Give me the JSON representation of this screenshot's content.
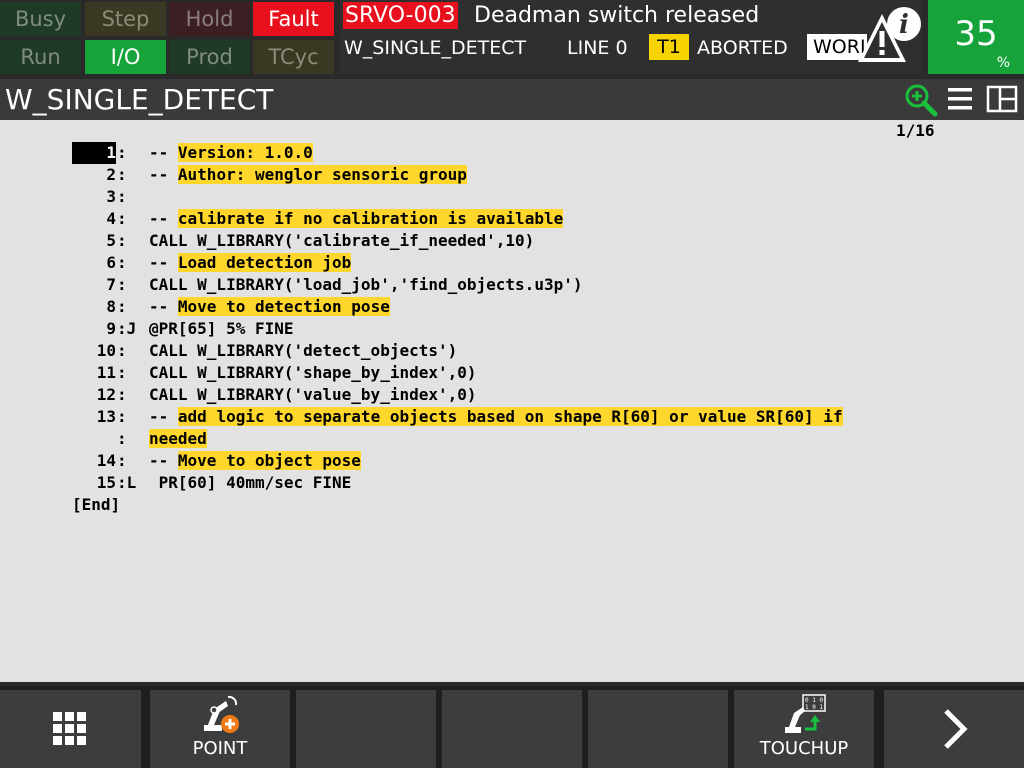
{
  "status_flags": {
    "busy": "Busy",
    "step": "Step",
    "hold": "Hold",
    "fault": "Fault",
    "run": "Run",
    "io": "I/O",
    "prod": "Prod",
    "tcyc": "TCyc"
  },
  "alarm": {
    "code": "SRVO-003",
    "message": "Deadman switch released",
    "program": "W_SINGLE_DETECT",
    "line": "LINE 0",
    "mode": "T1",
    "state": "ABORTED",
    "status_box": "WORLD",
    "icon": "warning-info-icon"
  },
  "override": {
    "value": "35",
    "unit": "%"
  },
  "title": "W_SINGLE_DETECT",
  "toolbar_icons": [
    "zoom-in-icon",
    "menu-icon",
    "split-view-icon"
  ],
  "editor": {
    "page_indicator": "1/16",
    "lines": [
      {
        "num": "1",
        "marker": ":",
        "prefix": "-- ",
        "text": "Version: 1.0.0",
        "comment": true,
        "selected": true
      },
      {
        "num": "2",
        "marker": ":",
        "prefix": "-- ",
        "text": "Author: wenglor sensoric group",
        "comment": true
      },
      {
        "num": "3",
        "marker": ":",
        "prefix": "",
        "text": ""
      },
      {
        "num": "4",
        "marker": ":",
        "prefix": "-- ",
        "text": "calibrate if no calibration is available",
        "comment": true
      },
      {
        "num": "5",
        "marker": ":",
        "prefix": "",
        "text": "CALL W_LIBRARY('calibrate_if_needed',10)"
      },
      {
        "num": "6",
        "marker": ":",
        "prefix": "-- ",
        "text": "Load detection job",
        "comment": true
      },
      {
        "num": "7",
        "marker": ":",
        "prefix": "",
        "text": "CALL W_LIBRARY('load_job','find_objects.u3p')"
      },
      {
        "num": "8",
        "marker": ":",
        "prefix": "-- ",
        "text": "Move to detection pose",
        "comment": true
      },
      {
        "num": "9",
        "marker": ":J",
        "prefix": "",
        "text": "@PR[65] 5% FINE"
      },
      {
        "num": "10",
        "marker": ":",
        "prefix": "",
        "text": "CALL W_LIBRARY('detect_objects')"
      },
      {
        "num": "11",
        "marker": ":",
        "prefix": "",
        "text": "CALL W_LIBRARY('shape_by_index',0)"
      },
      {
        "num": "12",
        "marker": ":",
        "prefix": "",
        "text": "CALL W_LIBRARY('value_by_index',0)"
      },
      {
        "num": "13",
        "marker": ":",
        "prefix": "-- ",
        "text": "add logic to separate objects based on shape R[60] or value SR[60] if",
        "comment": true
      },
      {
        "num": "",
        "marker": ":",
        "prefix": "",
        "text": "needed",
        "comment": true
      },
      {
        "num": "14",
        "marker": ":",
        "prefix": "-- ",
        "text": "Move to object pose",
        "comment": true
      },
      {
        "num": "15",
        "marker": ":L",
        "prefix": "",
        "text": " PR[60] 40mm/sec FINE"
      }
    ],
    "end_marker": "[End]"
  },
  "function_keys": [
    {
      "label": "",
      "icon": "grid-menu-icon"
    },
    {
      "label": "POINT",
      "icon": "robot-add-point-icon"
    },
    {
      "label": ""
    },
    {
      "label": ""
    },
    {
      "label": ""
    },
    {
      "label": "TOUCHUP",
      "icon": "robot-touchup-icon"
    },
    {
      "label": "",
      "icon": "chevron-right-icon"
    }
  ]
}
